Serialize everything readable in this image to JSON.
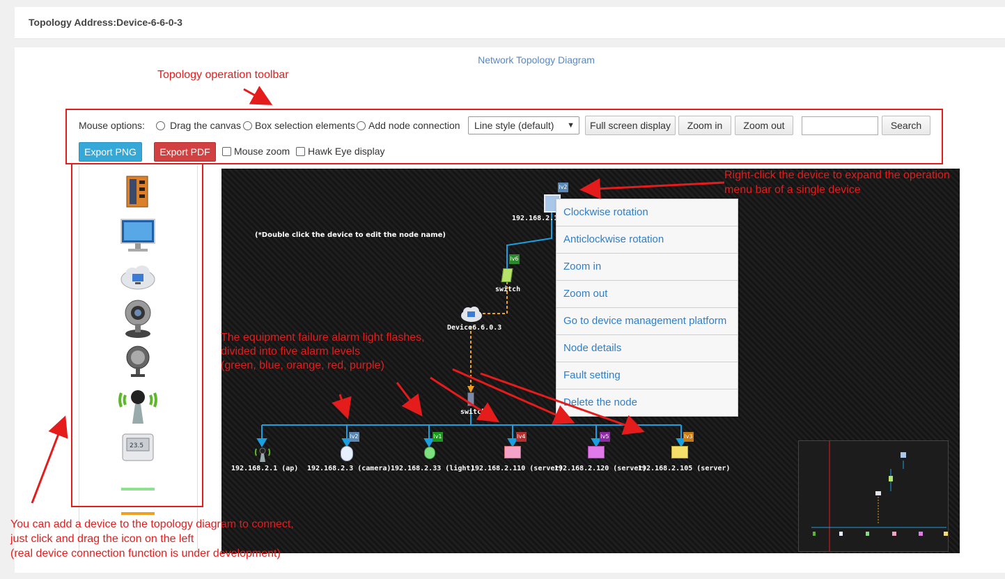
{
  "header": {
    "title": "Topology Address:Device-6-6-0-3"
  },
  "diagram_title": "Network Topology Diagram",
  "toolbar": {
    "mouse_options_label": "Mouse options:",
    "radio_drag": "Drag the canvas",
    "radio_box": "Box selection elements",
    "radio_add": "Add node connection",
    "line_style": "Line style (default)",
    "full_screen": "Full screen display",
    "zoom_in": "Zoom in",
    "zoom_out": "Zoom out",
    "search_placeholder": "",
    "search": "Search",
    "export_png": "Export PNG",
    "export_pdf": "Export PDF",
    "mouse_zoom": "Mouse zoom",
    "hawk_eye": "Hawk Eye display",
    "colors": {
      "export_png": "#35a8d8",
      "export_pdf": "#d24141"
    }
  },
  "palette": {
    "icons": [
      "industrial-switch-icon",
      "monitor-icon",
      "cloud-computer-icon",
      "webcam-icon",
      "spotlight-icon",
      "wireless-ap-icon",
      "thermometer-icon",
      "green-line-icon",
      "orange-line-icon"
    ]
  },
  "canvas": {
    "hint": "(*Double click the device to edit the node name)",
    "nodes": {
      "top": {
        "label": "192.168.2.10",
        "level": "lv2"
      },
      "switch1": {
        "label": "switch",
        "level": "lv6"
      },
      "cloud": {
        "label": "Device6.6.0.3"
      },
      "switch2": {
        "label": "switch"
      },
      "bottom": [
        {
          "label": "192.168.2.1  (ap)",
          "level": ""
        },
        {
          "label": "192.168.2.3  (camera)",
          "level": "lv2"
        },
        {
          "label": "192.168.2.33  (light)",
          "level": "lv1"
        },
        {
          "label": "192.168.2.110  (server)",
          "level": "lv4"
        },
        {
          "label": "192.168.2.120  (server)",
          "level": "lv5"
        },
        {
          "label": "192.168.2.105  (server)",
          "level": "lv3"
        }
      ]
    },
    "level_colors": {
      "lv1": "#1a9a1a",
      "lv2": "#5b87b5",
      "lv3": "#c87a14",
      "lv4": "#b33030",
      "lv5": "#8e2aa6",
      "lv6": "#2a8a2a"
    }
  },
  "context_menu": [
    "Clockwise rotation",
    "Anticlockwise rotation",
    "Zoom in",
    "Zoom out",
    "Go to device management platform",
    "Node details",
    "Fault setting",
    "Delete the node"
  ],
  "annotations": {
    "toolbar": "Topology operation toolbar",
    "right_click_1": "Right-click the device to expand the operation",
    "right_click_2": "menu bar of a single device",
    "alarm_1": "The equipment failure alarm light flashes,",
    "alarm_2": "divided into five alarm levels",
    "alarm_3": "(green, blue, orange, red, purple)",
    "left_1": "You can add a device to the topology diagram to connect,",
    "left_2": " just click and drag the icon on the left",
    "left_3": "(real device connection function is under development)"
  }
}
